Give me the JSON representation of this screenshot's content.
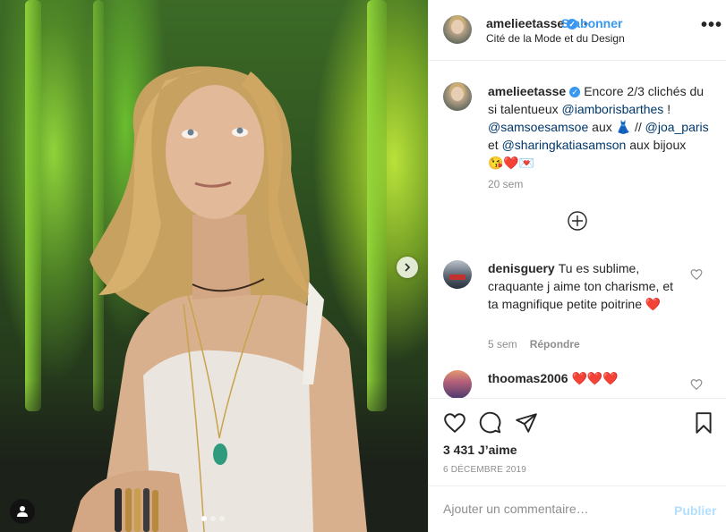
{
  "post": {
    "username": "amelieetasse",
    "follow_label": "S’abonner",
    "separator": "•",
    "location": "Cité de la Mode et du Design",
    "more_label": "•••"
  },
  "caption": {
    "username": "amelieetasse",
    "t1": "Encore 2/3 clichés du si talentueux",
    "m1": "@iamborisbarthes",
    "t2": " !",
    "m2": "@samsoesamsoe",
    "t3": " aux ",
    "e1": "👗",
    "t4": " // ",
    "m3": "@joa_paris",
    "t5": " et ",
    "m4": "@sharingkatiasamson",
    "t6": " aux bijoux",
    "emojis": "😘❤️💌",
    "time": "20 sem"
  },
  "comments": [
    {
      "username": "denisguery",
      "text": "Tu es sublime, craquante j aime ton charisme, et ta magnifique petite poitrine",
      "emoji": "❤️",
      "time": "5 sem",
      "reply_label": "Répondre"
    },
    {
      "username": "thoomas2006",
      "emoji": "❤️❤️❤️"
    }
  ],
  "stats": {
    "likes": "3 431 J’aime",
    "date": "6 DÉCEMBRE 2019"
  },
  "composer": {
    "placeholder": "Ajouter un commentaire…",
    "publish_label": "Publier"
  },
  "carousel": {
    "count": 3,
    "active": 0
  },
  "colors": {
    "accent": "#3897f0",
    "mention": "#00376b",
    "muted": "#8e8e8e",
    "publish_disabled": "#b2dffc",
    "heart": "#ed4956"
  }
}
